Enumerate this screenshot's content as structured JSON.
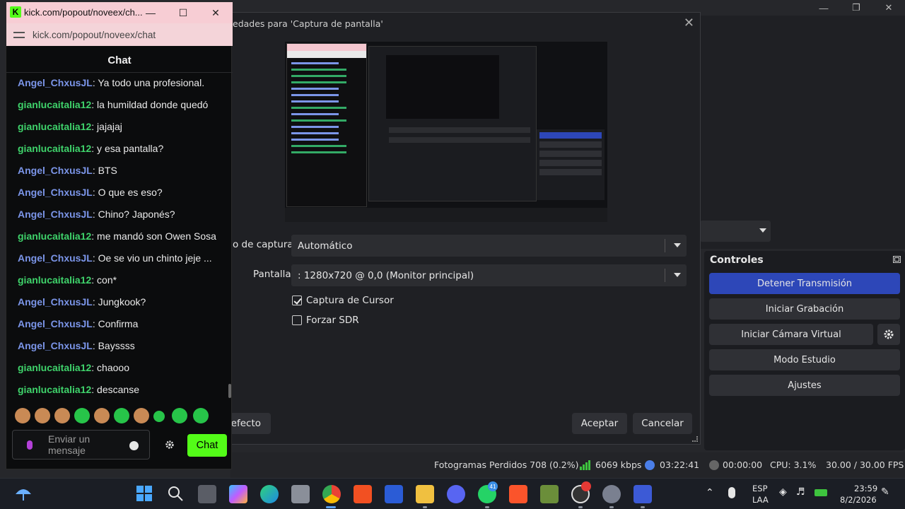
{
  "chat_window": {
    "title": "kick.com/popout/noveex/ch...",
    "url": "kick.com/popout/noveex/chat",
    "header": "Chat",
    "messages": [
      {
        "user": "Angel_ChxusJL",
        "text": ": Ya todo una profesional.",
        "color": "#7b95e8"
      },
      {
        "user": "gianlucaitalia12",
        "text": ": la humildad donde quedó",
        "color": "#3fd36b"
      },
      {
        "user": "gianlucaitalia12",
        "text": ": jajajaj",
        "color": "#3fd36b"
      },
      {
        "user": "gianlucaitalia12",
        "text": ": y esa pantalla?",
        "color": "#3fd36b"
      },
      {
        "user": "Angel_ChxusJL",
        "text": ": BTS",
        "color": "#7b95e8"
      },
      {
        "user": "Angel_ChxusJL",
        "text": ": O que es eso?",
        "color": "#7b95e8"
      },
      {
        "user": "Angel_ChxusJL",
        "text": ": Chino? Japonés?",
        "color": "#7b95e8"
      },
      {
        "user": "gianlucaitalia12",
        "text": ": me mandó son Owen Sosa",
        "color": "#3fd36b"
      },
      {
        "user": "Angel_ChxusJL",
        "text": ": Oe se vio un chinto jeje ...",
        "color": "#7b95e8"
      },
      {
        "user": "gianlucaitalia12",
        "text": ": con*",
        "color": "#3fd36b"
      },
      {
        "user": "Angel_ChxusJL",
        "text": ": Jungkook?",
        "color": "#7b95e8"
      },
      {
        "user": "Angel_ChxusJL",
        "text": ": Confirma",
        "color": "#7b95e8"
      },
      {
        "user": "Angel_ChxusJL",
        "text": ": Bayssss",
        "color": "#7b95e8"
      },
      {
        "user": "gianlucaitalia12",
        "text": ": chaooo",
        "color": "#3fd36b"
      },
      {
        "user": "gianlucaitalia12",
        "text": ": descanse",
        "color": "#3fd36b"
      }
    ],
    "input_placeholder": "Enviar un mensaje",
    "send_label": "Chat"
  },
  "dialog": {
    "title": "edades para 'Captura de pantalla'",
    "capture_method_label": "o de captura",
    "capture_method_value": "Automático",
    "screen_label": "Pantalla",
    "screen_value": ": 1280x720 @ 0,0 (Monitor principal)",
    "cursor_capture_label": "Captura de Cursor",
    "cursor_capture_checked": true,
    "force_sdr_label": "Forzar SDR",
    "force_sdr_checked": false,
    "defaults_label": "efecto",
    "accept_label": "Aceptar",
    "cancel_label": "Cancelar"
  },
  "controls": {
    "title": "Controles",
    "stop_stream": "Detener Transmisión",
    "start_recording": "Iniciar Grabación",
    "start_virtual_cam": "Iniciar Cámara Virtual",
    "studio_mode": "Modo Estudio",
    "settings": "Ajustes"
  },
  "status": {
    "dropped_frames": "Fotogramas Perdidos 708 (0.2%)",
    "bitrate": "6069 kbps",
    "stream_time": "03:22:41",
    "rec_time": "00:00:00",
    "cpu": "CPU: 3.1%",
    "fps": "30.00 / 30.00 FPS"
  },
  "taskbar": {
    "language_top": "ESP",
    "language_bottom": "LAA",
    "time": "23:59",
    "date": "8/2/2026",
    "whatsapp_badge": "41"
  },
  "colors": {
    "kick_green": "#53fc18",
    "obs_accent": "#2d47b8"
  }
}
